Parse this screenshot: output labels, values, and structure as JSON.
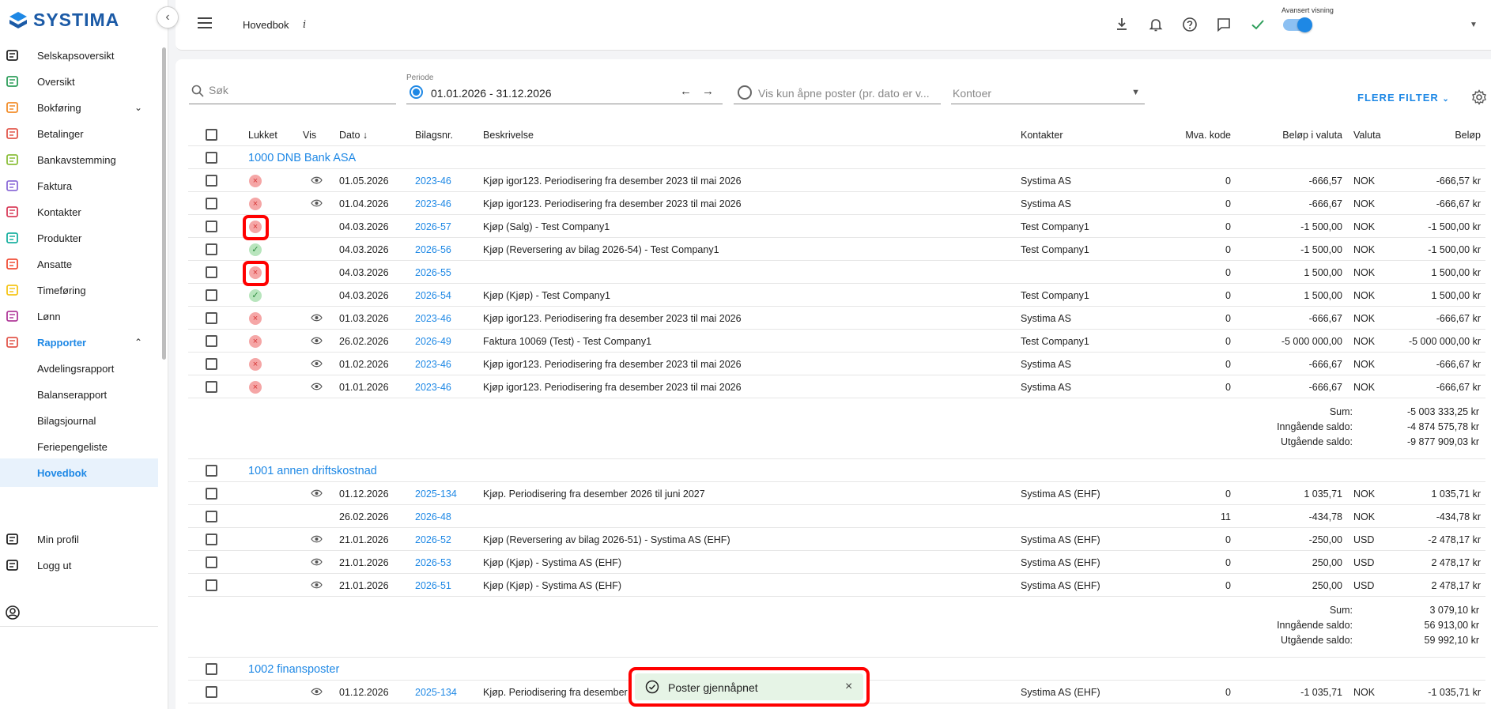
{
  "brand": {
    "name": "SYSTIMA"
  },
  "sidebar": {
    "items": [
      {
        "label": "Selskapsoversikt",
        "icon": "building-icon",
        "color": "#222222"
      },
      {
        "label": "Oversikt",
        "icon": "home-icon",
        "color": "#2e9e5b"
      },
      {
        "label": "Bokføring",
        "icon": "bookkeeping-icon",
        "color": "#f28c28",
        "chevron": "down"
      },
      {
        "label": "Betalinger",
        "icon": "payments-icon",
        "color": "#e2574c"
      },
      {
        "label": "Bankavstemming",
        "icon": "bank-reconcile-icon",
        "color": "#8bbf3a"
      },
      {
        "label": "Faktura",
        "icon": "invoice-icon",
        "color": "#8c6cd8"
      },
      {
        "label": "Kontakter",
        "icon": "contacts-icon",
        "color": "#d93e5b"
      },
      {
        "label": "Produkter",
        "icon": "products-icon",
        "color": "#1ab0a0"
      },
      {
        "label": "Ansatte",
        "icon": "employees-icon",
        "color": "#f04e37"
      },
      {
        "label": "Timeføring",
        "icon": "clock-icon",
        "color": "#f5c518"
      },
      {
        "label": "Lønn",
        "icon": "salary-icon",
        "color": "#b03a9a"
      },
      {
        "label": "Rapporter",
        "icon": "reports-icon",
        "color": "#e2574c",
        "chevron": "up"
      }
    ],
    "sub_items": [
      "Avdelingsrapport",
      "Balanserapport",
      "Bilagsjournal",
      "Feriepengeliste",
      "Hovedbok"
    ],
    "footer": [
      {
        "label": "Min profil",
        "icon": "gear-icon"
      },
      {
        "label": "Logg ut",
        "icon": "logout-icon"
      }
    ]
  },
  "topbar": {
    "title": "Hovedbok",
    "info": "i",
    "advanced_label": "Avansert visning"
  },
  "filters": {
    "search_placeholder": "Søk",
    "periode_label": "Periode",
    "periode_value": "01.01.2026 - 31.12.2026",
    "prev_arrow": "←",
    "next_arrow": "→",
    "open_posts_label": "Vis kun åpne poster (pr. dato er v...",
    "kontoer_label": "Kontoer",
    "more_filters": "FLERE FILTER"
  },
  "table": {
    "headers": {
      "lukket": "Lukket",
      "vis": "Vis",
      "dato": "Dato",
      "bilag": "Bilagsnr.",
      "beskrivelse": "Beskrivelse",
      "kontakter": "Kontakter",
      "mva": "Mva. kode",
      "belop_valuta": "Beløp i valuta",
      "valuta": "Valuta",
      "belop": "Beløp"
    },
    "groups": [
      {
        "title": "1000 DNB Bank ASA",
        "rows": [
          {
            "status": "x",
            "vis": true,
            "dato": "01.05.2026",
            "bilag": "2023-46",
            "beskrivelse": "Kjøp igor123. Periodisering fra desember 2023 til mai 2026",
            "kontakt": "Systima AS",
            "mva": "0",
            "bv": "-666,57",
            "valuta": "NOK",
            "belop": "-666,57 kr"
          },
          {
            "status": "x",
            "vis": true,
            "dato": "01.04.2026",
            "bilag": "2023-46",
            "beskrivelse": "Kjøp igor123. Periodisering fra desember 2023 til mai 2026",
            "kontakt": "Systima AS",
            "mva": "0",
            "bv": "-666,67",
            "valuta": "NOK",
            "belop": "-666,67 kr"
          },
          {
            "status": "x",
            "vis": false,
            "highlight": true,
            "dato": "04.03.2026",
            "bilag": "2026-57",
            "beskrivelse": "Kjøp (Salg) - Test Company1",
            "kontakt": "Test Company1",
            "mva": "0",
            "bv": "-1 500,00",
            "valuta": "NOK",
            "belop": "-1 500,00 kr"
          },
          {
            "status": "ok",
            "vis": false,
            "dato": "04.03.2026",
            "bilag": "2026-56",
            "beskrivelse": "Kjøp (Reversering av bilag 2026-54) - Test Company1",
            "kontakt": "Test Company1",
            "mva": "0",
            "bv": "-1 500,00",
            "valuta": "NOK",
            "belop": "-1 500,00 kr"
          },
          {
            "status": "x",
            "vis": false,
            "highlight": true,
            "dato": "04.03.2026",
            "bilag": "2026-55",
            "beskrivelse": "",
            "kontakt": "",
            "mva": "0",
            "bv": "1 500,00",
            "valuta": "NOK",
            "belop": "1 500,00 kr"
          },
          {
            "status": "ok",
            "vis": false,
            "dato": "04.03.2026",
            "bilag": "2026-54",
            "beskrivelse": "Kjøp (Kjøp) - Test Company1",
            "kontakt": "Test Company1",
            "mva": "0",
            "bv": "1 500,00",
            "valuta": "NOK",
            "belop": "1 500,00 kr"
          },
          {
            "status": "x",
            "vis": true,
            "dato": "01.03.2026",
            "bilag": "2023-46",
            "beskrivelse": "Kjøp igor123. Periodisering fra desember 2023 til mai 2026",
            "kontakt": "Systima AS",
            "mva": "0",
            "bv": "-666,67",
            "valuta": "NOK",
            "belop": "-666,67 kr"
          },
          {
            "status": "x",
            "vis": true,
            "dato": "26.02.2026",
            "bilag": "2026-49",
            "beskrivelse": "Faktura 10069 (Test) - Test Company1",
            "kontakt": "Test Company1",
            "mva": "0",
            "bv": "-5 000 000,00",
            "valuta": "NOK",
            "belop": "-5 000 000,00 kr"
          },
          {
            "status": "x",
            "vis": true,
            "dato": "01.02.2026",
            "bilag": "2023-46",
            "beskrivelse": "Kjøp igor123. Periodisering fra desember 2023 til mai 2026",
            "kontakt": "Systima AS",
            "mva": "0",
            "bv": "-666,67",
            "valuta": "NOK",
            "belop": "-666,67 kr"
          },
          {
            "status": "x",
            "vis": true,
            "dato": "01.01.2026",
            "bilag": "2023-46",
            "beskrivelse": "Kjøp igor123. Periodisering fra desember 2023 til mai 2026",
            "kontakt": "Systima AS",
            "mva": "0",
            "bv": "-666,67",
            "valuta": "NOK",
            "belop": "-666,67 kr"
          }
        ],
        "sums": [
          {
            "label": "Sum:",
            "value": "-5 003 333,25 kr"
          },
          {
            "label": "Inngående saldo:",
            "value": "-4 874 575,78 kr"
          },
          {
            "label": "Utgående saldo:",
            "value": "-9 877 909,03 kr"
          }
        ]
      },
      {
        "title": "1001 annen driftskostnad",
        "rows": [
          {
            "status": "",
            "vis": true,
            "dato": "01.12.2026",
            "bilag": "2025-134",
            "beskrivelse": "Kjøp. Periodisering fra desember 2026 til juni 2027",
            "kontakt": "Systima AS (EHF)",
            "mva": "0",
            "bv": "1 035,71",
            "valuta": "NOK",
            "belop": "1 035,71 kr"
          },
          {
            "status": "",
            "vis": false,
            "dato": "26.02.2026",
            "bilag": "2026-48",
            "beskrivelse": "",
            "kontakt": "",
            "mva": "11",
            "bv": "-434,78",
            "valuta": "NOK",
            "belop": "-434,78 kr"
          },
          {
            "status": "",
            "vis": true,
            "dato": "21.01.2026",
            "bilag": "2026-52",
            "beskrivelse": "Kjøp (Reversering av bilag 2026-51) - Systima AS (EHF)",
            "kontakt": "Systima AS (EHF)",
            "mva": "0",
            "bv": "-250,00",
            "valuta": "USD",
            "belop": "-2 478,17 kr"
          },
          {
            "status": "",
            "vis": true,
            "dato": "21.01.2026",
            "bilag": "2026-53",
            "beskrivelse": "Kjøp (Kjøp) - Systima AS (EHF)",
            "kontakt": "Systima AS (EHF)",
            "mva": "0",
            "bv": "250,00",
            "valuta": "USD",
            "belop": "2 478,17 kr"
          },
          {
            "status": "",
            "vis": true,
            "dato": "21.01.2026",
            "bilag": "2026-51",
            "beskrivelse": "Kjøp (Kjøp) - Systima AS (EHF)",
            "kontakt": "Systima AS (EHF)",
            "mva": "0",
            "bv": "250,00",
            "valuta": "USD",
            "belop": "2 478,17 kr"
          }
        ],
        "sums": [
          {
            "label": "Sum:",
            "value": "3 079,10 kr"
          },
          {
            "label": "Inngående saldo:",
            "value": "56 913,00 kr"
          },
          {
            "label": "Utgående saldo:",
            "value": "59 992,10 kr"
          }
        ]
      },
      {
        "title": "1002 finansposter",
        "rows": [
          {
            "status": "",
            "vis": true,
            "dato": "01.12.2026",
            "bilag": "2025-134",
            "beskrivelse": "Kjøp. Periodisering fra desember 2026 til juni 2027",
            "kontakt": "Systima AS (EHF)",
            "mva": "0",
            "bv": "-1 035,71",
            "valuta": "NOK",
            "belop": "-1 035,71 kr"
          }
        ],
        "sums": []
      }
    ]
  },
  "toast": {
    "message": "Poster gjennåpnet",
    "close": "×"
  },
  "colors": {
    "accent": "#1e88e5",
    "highlight": "#ff0000",
    "success": "#2e8b3e",
    "error": "#d63636"
  }
}
